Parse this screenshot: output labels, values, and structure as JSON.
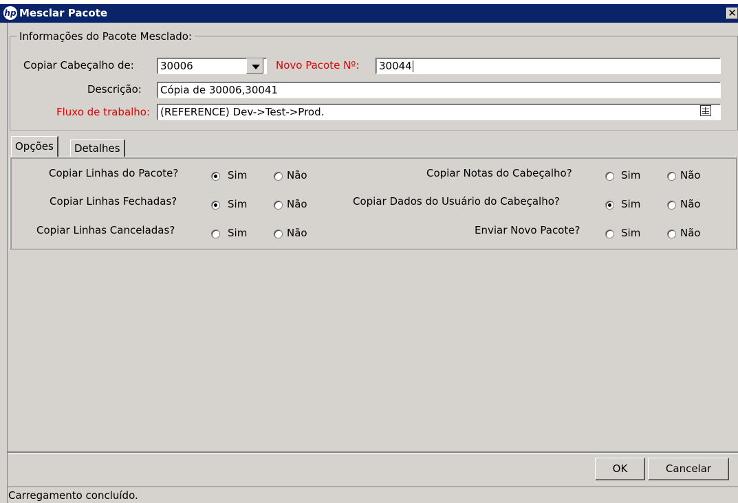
{
  "window": {
    "title": "Mesclar Pacote",
    "close_glyph": "✕"
  },
  "group": {
    "title": "Informações do Pacote Mesclado:"
  },
  "header": {
    "copy_header_label": "Copiar Cabeçalho de:",
    "copy_header_value": "30006",
    "new_package_label": "Novo Pacote Nº:",
    "new_package_value": "30044",
    "description_label": "Descrição:",
    "description_value": "Cópia de 30006,30041",
    "workflow_label": "Fluxo de trabalho:",
    "workflow_value": "(REFERENCE) Dev->Test->Prod.",
    "required_label_color": "#e00000"
  },
  "tabs": [
    {
      "label": "Opções",
      "selected": true
    },
    {
      "label": "Detalhes",
      "selected": false
    }
  ],
  "options": {
    "yes": "Sim",
    "no": "Não",
    "left": [
      {
        "question": "Copiar Linhas do Pacote?",
        "selected": "yes"
      },
      {
        "question": "Copiar Linhas Fechadas?",
        "selected": "yes"
      },
      {
        "question": "Copiar Linhas Canceladas?",
        "selected": "none"
      }
    ],
    "right": [
      {
        "question": "Copiar Notas do Cabeçalho?",
        "selected": "none"
      },
      {
        "question": "Copiar Dados do Usuário do Cabeçalho?",
        "selected": "yes"
      },
      {
        "question": "Enviar Novo Pacote?",
        "selected": "none"
      }
    ]
  },
  "buttons": {
    "ok": "OK",
    "cancel": "Cancelar"
  },
  "status": {
    "text": "Carregamento concluído."
  },
  "icons": {
    "app_logo": "hp-logo-icon",
    "combo_arrow": "chevron-down-icon",
    "lookup": "table-lookup-icon"
  }
}
